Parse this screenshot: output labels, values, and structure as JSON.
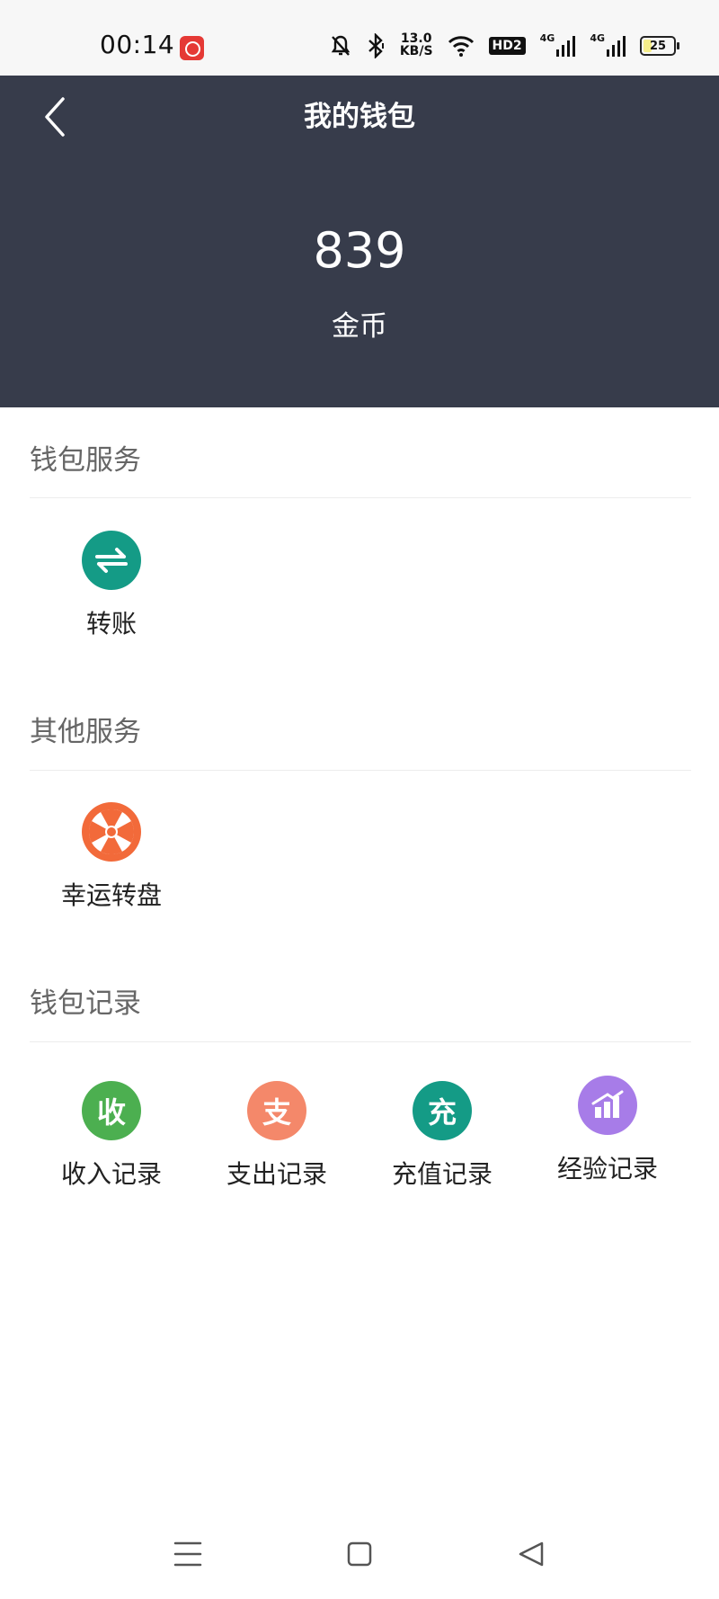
{
  "status_bar": {
    "time": "00:14",
    "net_speed_value": "13.0",
    "net_speed_unit": "KB/S",
    "hd_label": "HD2",
    "signal1_label": "4G",
    "signal2_label": "4G",
    "battery_level": "25",
    "icons": [
      "netease-music-icon",
      "mute-icon",
      "bluetooth-icon",
      "wifi-icon",
      "hd-icon",
      "signal-icon",
      "battery-icon"
    ]
  },
  "header": {
    "title": "我的钱包",
    "balance": "839",
    "unit": "金币",
    "background": "#373c4b"
  },
  "sections": {
    "wallet_service": {
      "title": "钱包服务",
      "items": [
        {
          "label": "转账",
          "icon": "transfer-icon",
          "color": "#149b86"
        }
      ]
    },
    "other_service": {
      "title": "其他服务",
      "items": [
        {
          "label": "幸运转盘",
          "icon": "lucky-wheel-icon",
          "color": "#f26a3a"
        }
      ]
    },
    "wallet_records": {
      "title": "钱包记录",
      "items": [
        {
          "label": "收入记录",
          "glyph": "收",
          "color": "#4caf50"
        },
        {
          "label": "支出记录",
          "glyph": "支",
          "color": "#f4886a"
        },
        {
          "label": "充值记录",
          "glyph": "充",
          "color": "#149b86"
        },
        {
          "label": "经验记录",
          "icon": "bar-chart-up-icon",
          "color": "#a77ce8"
        }
      ]
    }
  },
  "nav_bar": {
    "buttons": [
      "menu-icon",
      "home-square-icon",
      "back-triangle-icon"
    ]
  }
}
